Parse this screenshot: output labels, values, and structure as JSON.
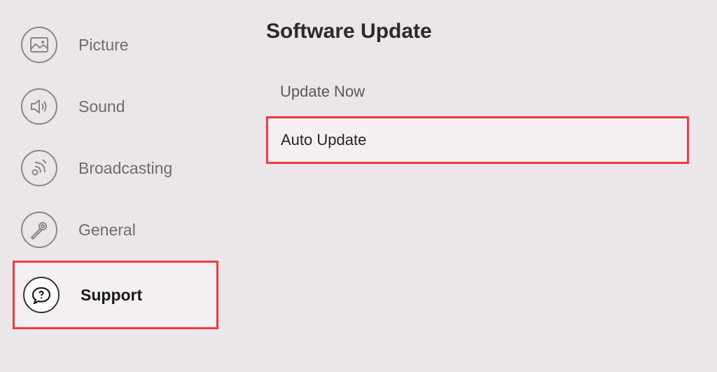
{
  "sidebar": {
    "items": [
      {
        "label": "Picture",
        "icon": "picture-icon",
        "selected": false
      },
      {
        "label": "Sound",
        "icon": "sound-icon",
        "selected": false
      },
      {
        "label": "Broadcasting",
        "icon": "broadcasting-icon",
        "selected": false
      },
      {
        "label": "General",
        "icon": "general-icon",
        "selected": false
      },
      {
        "label": "Support",
        "icon": "support-icon",
        "selected": true
      }
    ]
  },
  "main": {
    "title": "Software Update",
    "options": [
      {
        "label": "Update Now",
        "highlighted": false
      },
      {
        "label": "Auto Update",
        "highlighted": true
      }
    ]
  }
}
